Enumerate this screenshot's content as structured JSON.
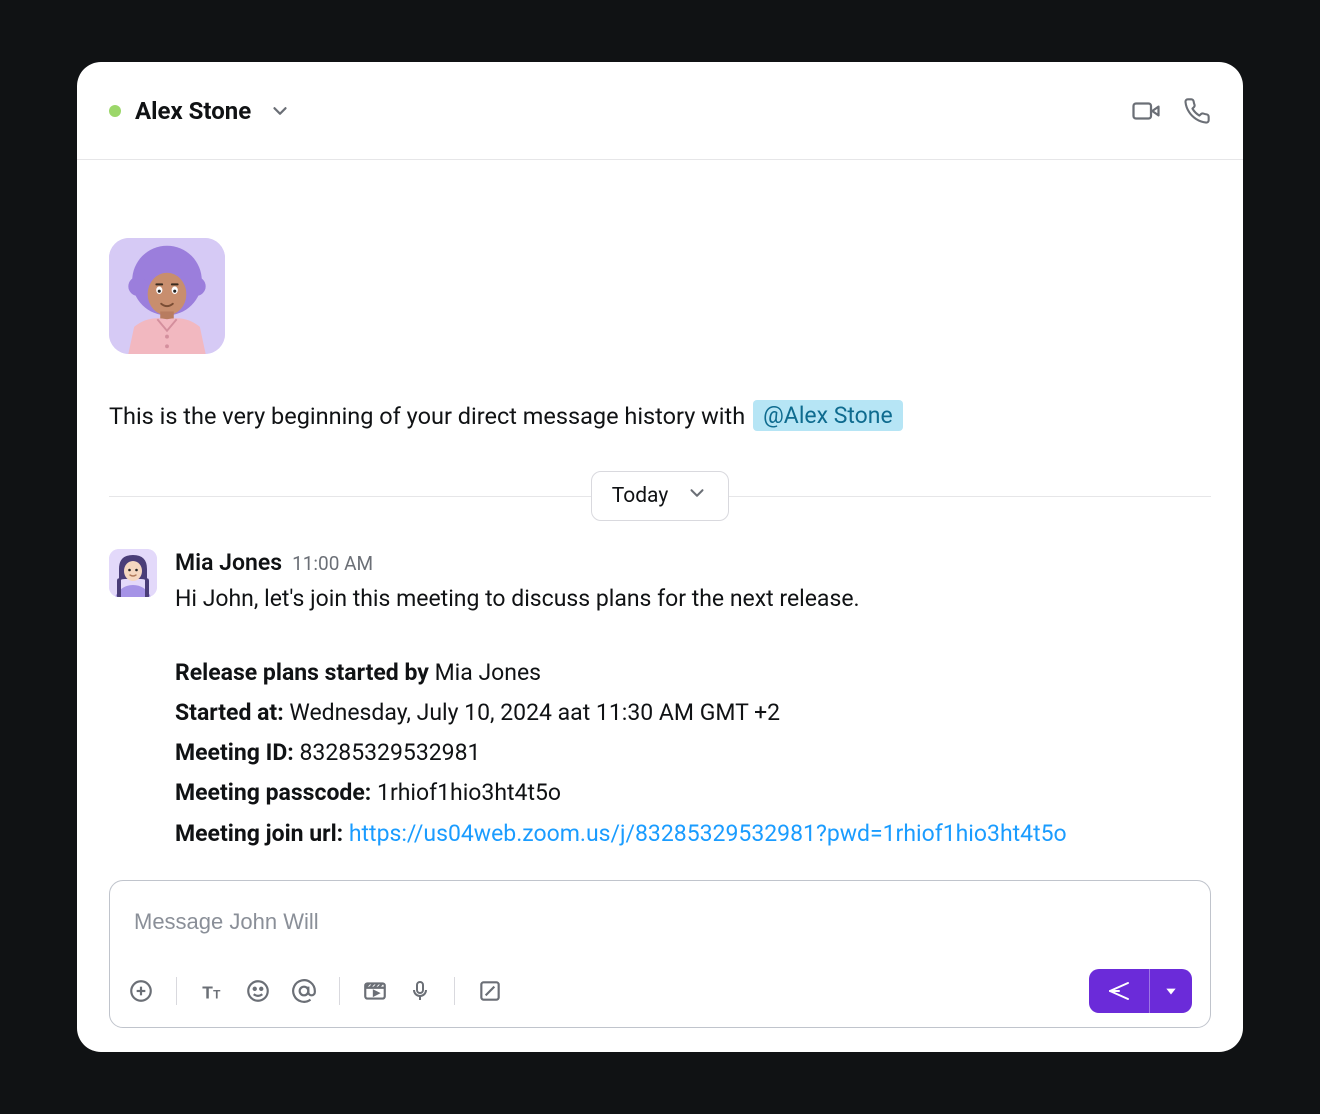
{
  "header": {
    "contact_name": "Alex Stone"
  },
  "intro": {
    "text_prefix": "This is the very beginning of your direct message history with",
    "mention": "@Alex Stone"
  },
  "date_divider": {
    "label": "Today"
  },
  "message": {
    "sender": "Mia Jones",
    "time": "11:00 AM",
    "text": "Hi John, let's join this meeting to discuss plans for the next release.",
    "meeting": {
      "title_label": "Release plans started by",
      "started_by": "Mia Jones",
      "started_at_label": "Started at:",
      "started_at": "Wednesday, July 10, 2024 aat 11:30 AM GMT +2",
      "meeting_id_label": "Meeting ID:",
      "meeting_id": "83285329532981",
      "passcode_label": "Meeting passcode:",
      "passcode": "1rhiof1hio3ht4t5o",
      "join_url_label": "Meeting join url:",
      "join_url": "https://us04web.zoom.us/j/83285329532981?pwd=1rhiof1hio3ht4t5o"
    }
  },
  "composer": {
    "placeholder": "Message John Will"
  },
  "colors": {
    "accent": "#6b2bd9",
    "presence": "#9cd76a",
    "mention_bg": "#b6e5f5",
    "link": "#1a9cff"
  }
}
